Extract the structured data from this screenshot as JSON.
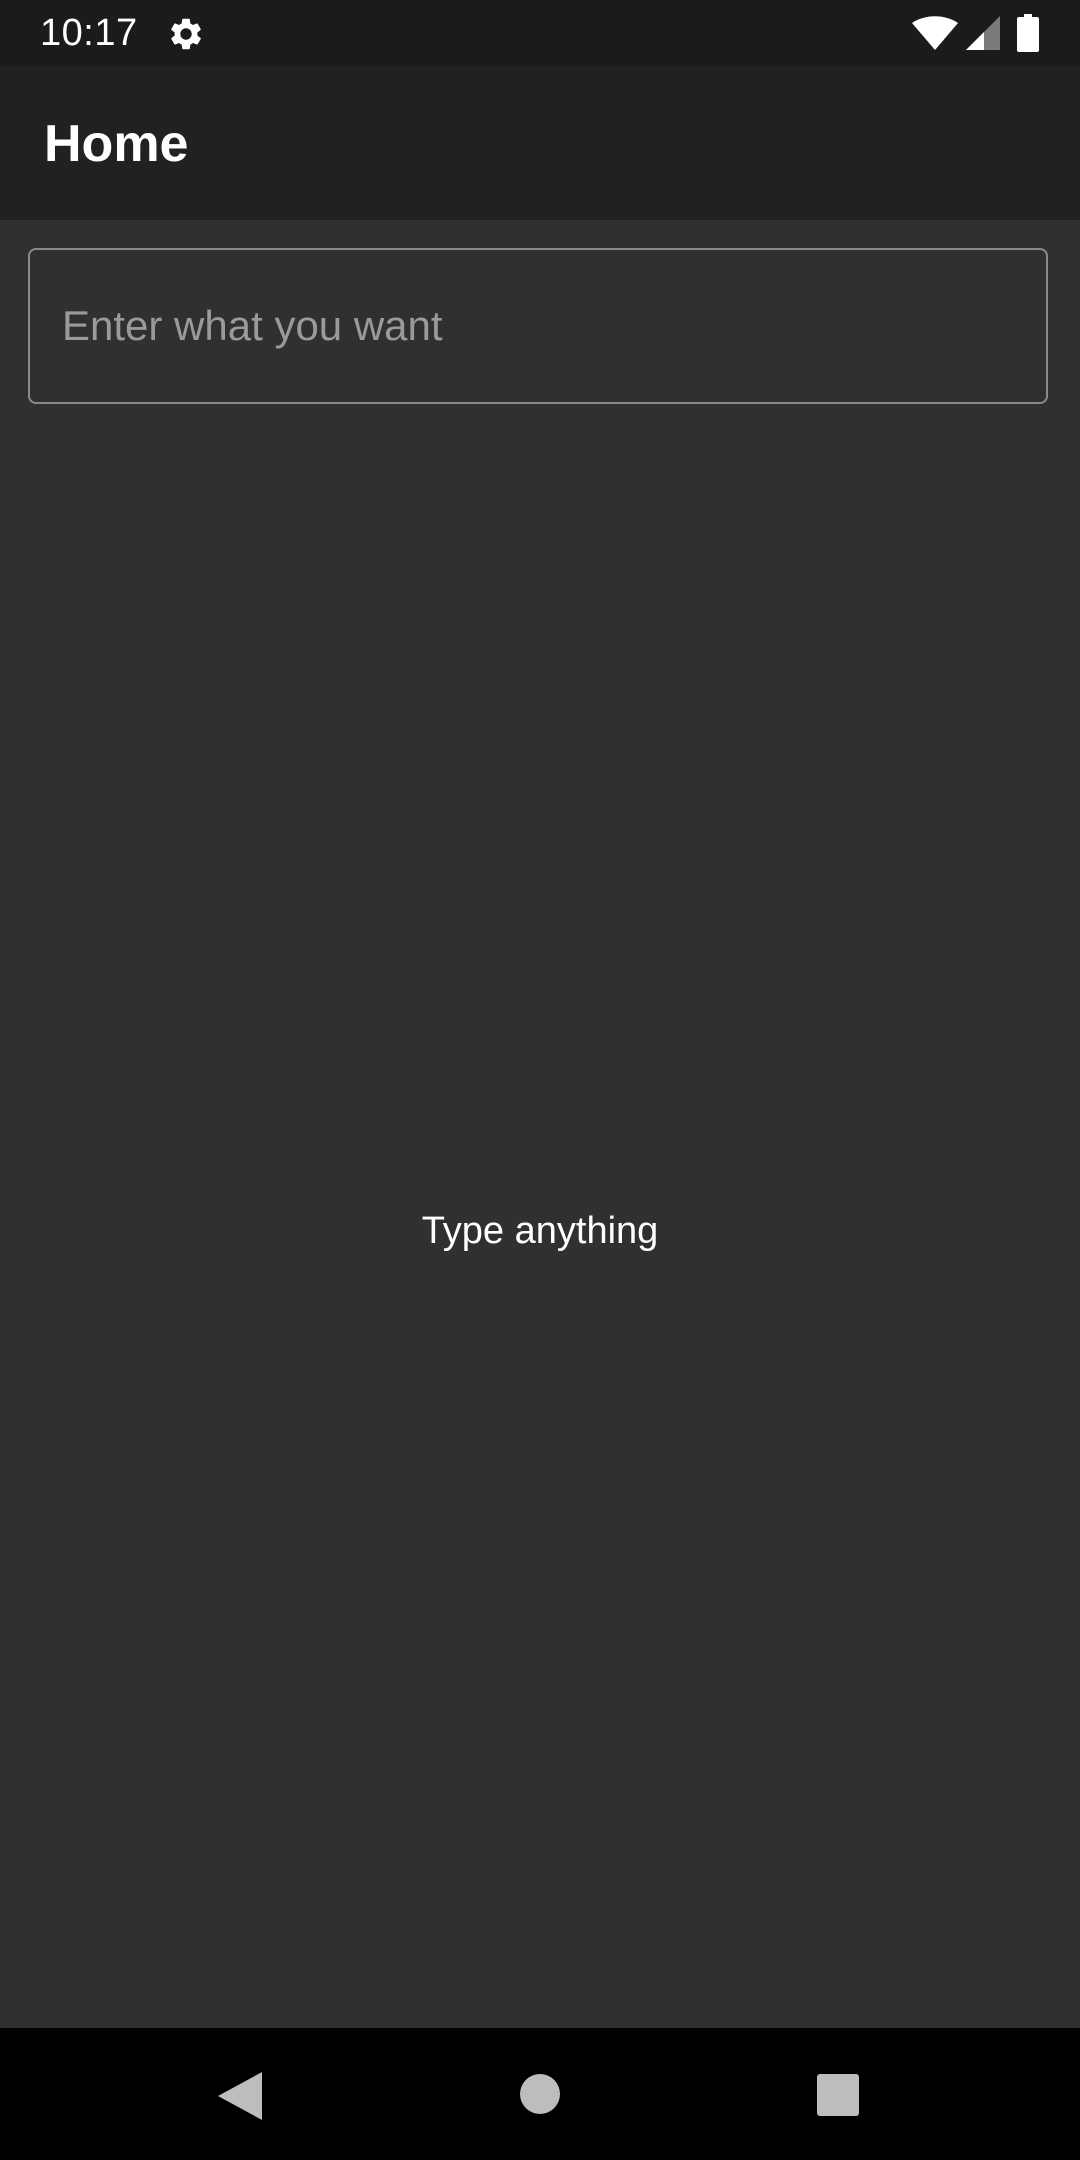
{
  "status_bar": {
    "time": "10:17",
    "icons": [
      "gear-icon",
      "wifi-icon",
      "signal-icon",
      "battery-icon"
    ]
  },
  "app_bar": {
    "title": "Home"
  },
  "input": {
    "placeholder": "Enter what you want",
    "value": ""
  },
  "main": {
    "message": "Type anything"
  },
  "nav_bar": {
    "icons": [
      "back-icon",
      "home-icon",
      "recents-icon"
    ]
  },
  "colors": {
    "background": "#303030",
    "app_bar": "#212121",
    "status_bar": "#1b1b1b",
    "nav_bar": "#000000",
    "input_border": "#8a8a8a",
    "placeholder": "#9a9a9a",
    "text": "#ffffff"
  }
}
